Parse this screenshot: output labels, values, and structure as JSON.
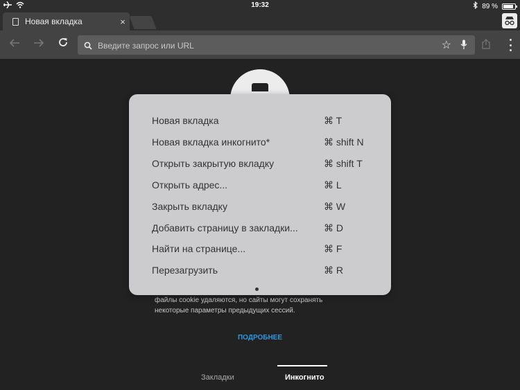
{
  "status_bar": {
    "time": "19:32",
    "battery": "89 %",
    "battery_level": 0.89
  },
  "tab": {
    "title": "Новая вкладка",
    "close": "×"
  },
  "toolbar": {
    "placeholder": "Введите запрос или URL",
    "star": "☆"
  },
  "content": {
    "description_line1": "файлы cookie удаляются, но сайты могут сохранять",
    "description_line2": "некоторые параметры предыдущих сессий.",
    "learn_more": "ПОДРОБНЕЕ"
  },
  "bottom_tabs": {
    "bookmarks": "Закладки",
    "incognito": "Инкогнито"
  },
  "shortcuts": [
    {
      "label": "Новая вкладка",
      "keys": "⌘ T"
    },
    {
      "label": "Новая вкладка инкогнито*",
      "keys": "⌘ shift N"
    },
    {
      "label": "Открыть закрытую вкладку",
      "keys": "⌘ shift T"
    },
    {
      "label": "Открыть адрес...",
      "keys": "⌘ L"
    },
    {
      "label": "Закрыть вкладку",
      "keys": "⌘ W"
    },
    {
      "label": "Добавить страницу в закладки...",
      "keys": "⌘ D"
    },
    {
      "label": "Найти на странице...",
      "keys": "⌘ F"
    },
    {
      "label": "Перезагрузить",
      "keys": "⌘ R"
    }
  ],
  "colors": {
    "background": "#222222",
    "toolbar": "#434343",
    "overlay": "#ccccce",
    "link": "#2f96e0"
  }
}
